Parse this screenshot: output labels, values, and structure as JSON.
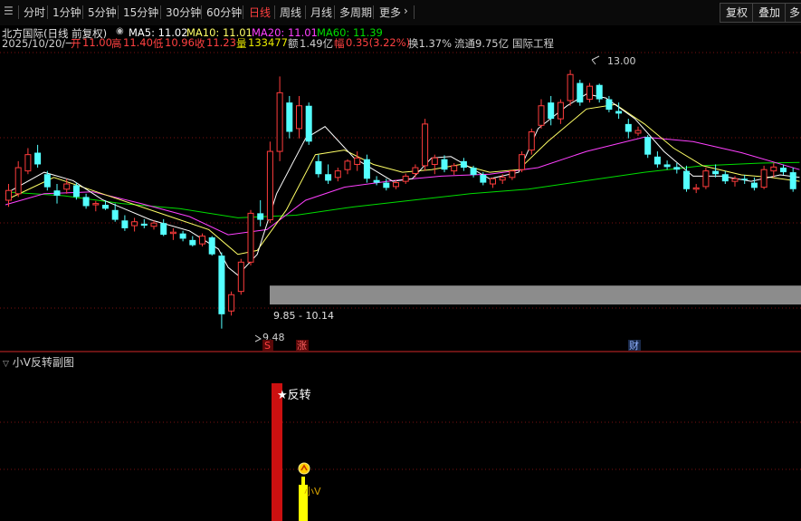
{
  "toolbar": {
    "timeframes": [
      "分时",
      "1分钟",
      "5分钟",
      "15分钟",
      "30分钟",
      "60分钟",
      "日线",
      "周线",
      "月线",
      "多周期",
      "更多"
    ],
    "more_arrow": "›",
    "active": "日线",
    "right_buttons": [
      "复权",
      "叠加",
      "多"
    ]
  },
  "info": {
    "name": "北方国际(日线 前复权)",
    "ma5": "MA5: 11.02",
    "ma10": "MA10: 11.01",
    "ma20": "MA20: 11.01",
    "ma60": "MA60: 11.39"
  },
  "quote": {
    "date": "2025/10/20/一",
    "open_label": "开",
    "open": "11.00",
    "high_label": "高",
    "high": "11.40",
    "low_label": "低",
    "low": "10.96",
    "close_label": "收",
    "close": "11.23",
    "vol_label": "量",
    "vol": "133477",
    "amount_label": "额",
    "amount": "1.49亿",
    "change_label": "幅",
    "change": "0.35(3.22%)",
    "turnover": "换1.37%",
    "float": "流通9.75亿",
    "industry": "国际工程"
  },
  "annotations": {
    "high_mark": "13.00",
    "low_mark": "9.48",
    "zone_label": "9.85 - 10.14",
    "marker_s": "S",
    "marker_zhang": "涨",
    "marker_cai": "财"
  },
  "subpanel": {
    "title": "小V反转副图",
    "reversal_label": "★反转",
    "small_v_label": "小V"
  },
  "colors": {
    "up": "#ff3c3c",
    "down": "#54ffff",
    "ma5": "#ffffff",
    "ma10": "#ffff66",
    "ma20": "#ff40ff",
    "ma60": "#00dd00",
    "zone": "#8c8c8c"
  },
  "chart_data": {
    "type": "candlestick",
    "ylim": [
      9.35,
      13.55
    ],
    "candles": [
      [
        11.45,
        11.7,
        11.35,
        11.6
      ],
      [
        11.55,
        12.05,
        11.5,
        11.95
      ],
      [
        11.9,
        12.25,
        11.85,
        12.15
      ],
      [
        12.18,
        12.3,
        11.95,
        12.0
      ],
      [
        11.85,
        11.9,
        11.6,
        11.65
      ],
      [
        11.6,
        11.7,
        11.4,
        11.52
      ],
      [
        11.62,
        11.78,
        11.55,
        11.7
      ],
      [
        11.68,
        11.72,
        11.46,
        11.5
      ],
      [
        11.5,
        11.55,
        11.32,
        11.36
      ],
      [
        11.38,
        11.44,
        11.28,
        11.4
      ],
      [
        11.38,
        11.45,
        11.3,
        11.32
      ],
      [
        11.3,
        11.4,
        11.12,
        11.15
      ],
      [
        11.14,
        11.22,
        10.98,
        11.02
      ],
      [
        11.06,
        11.18,
        10.97,
        11.12
      ],
      [
        11.09,
        11.16,
        11.02,
        11.06
      ],
      [
        11.05,
        11.14,
        11.0,
        11.1
      ],
      [
        11.1,
        11.16,
        10.9,
        10.92
      ],
      [
        10.94,
        11.02,
        10.84,
        10.96
      ],
      [
        10.94,
        10.98,
        10.82,
        10.86
      ],
      [
        10.84,
        10.9,
        10.74,
        10.76
      ],
      [
        10.78,
        10.94,
        10.74,
        10.9
      ],
      [
        10.88,
        10.9,
        10.6,
        10.62
      ],
      [
        10.6,
        10.65,
        9.48,
        9.7
      ],
      [
        9.75,
        10.05,
        9.68,
        10.0
      ],
      [
        10.05,
        10.55,
        10.0,
        10.5
      ],
      [
        10.5,
        11.3,
        10.45,
        11.25
      ],
      [
        11.25,
        11.45,
        11.05,
        11.15
      ],
      [
        11.15,
        12.35,
        11.1,
        12.2
      ],
      [
        12.2,
        13.35,
        12.05,
        13.1
      ],
      [
        12.95,
        13.05,
        12.4,
        12.5
      ],
      [
        12.55,
        13.05,
        12.4,
        12.9
      ],
      [
        12.9,
        12.95,
        12.3,
        12.35
      ],
      [
        12.05,
        12.15,
        11.8,
        11.85
      ],
      [
        11.85,
        12.0,
        11.7,
        11.75
      ],
      [
        11.8,
        11.95,
        11.74,
        11.9
      ],
      [
        11.92,
        12.08,
        11.85,
        12.05
      ],
      [
        12.0,
        12.2,
        11.9,
        12.1
      ],
      [
        12.08,
        12.15,
        11.72,
        11.78
      ],
      [
        11.76,
        11.82,
        11.68,
        11.72
      ],
      [
        11.72,
        11.78,
        11.6,
        11.64
      ],
      [
        11.66,
        11.76,
        11.62,
        11.72
      ],
      [
        11.74,
        11.86,
        11.7,
        11.82
      ],
      [
        11.86,
        12.0,
        11.8,
        11.95
      ],
      [
        11.98,
        12.7,
        11.9,
        12.62
      ],
      [
        12.0,
        12.15,
        11.85,
        12.1
      ],
      [
        12.08,
        12.14,
        11.88,
        11.92
      ],
      [
        11.9,
        12.02,
        11.84,
        11.98
      ],
      [
        12.05,
        12.1,
        11.9,
        11.95
      ],
      [
        11.95,
        11.98,
        11.8,
        11.84
      ],
      [
        11.84,
        11.88,
        11.68,
        11.72
      ],
      [
        11.7,
        11.8,
        11.64,
        11.78
      ],
      [
        11.76,
        11.85,
        11.7,
        11.8
      ],
      [
        11.8,
        11.92,
        11.76,
        11.9
      ],
      [
        11.92,
        12.2,
        11.88,
        12.15
      ],
      [
        12.22,
        12.55,
        12.15,
        12.5
      ],
      [
        12.6,
        13.0,
        12.55,
        12.9
      ],
      [
        12.95,
        13.05,
        12.6,
        12.7
      ],
      [
        12.7,
        13.0,
        12.62,
        12.95
      ],
      [
        12.98,
        13.45,
        12.9,
        13.38
      ],
      [
        13.25,
        13.3,
        12.9,
        12.95
      ],
      [
        13.0,
        13.25,
        12.95,
        13.2
      ],
      [
        13.22,
        13.24,
        12.95,
        13.0
      ],
      [
        13.0,
        13.05,
        12.8,
        12.84
      ],
      [
        12.82,
        12.95,
        12.7,
        12.78
      ],
      [
        12.62,
        12.7,
        12.4,
        12.5
      ],
      [
        12.48,
        12.58,
        12.44,
        12.52
      ],
      [
        12.42,
        12.45,
        12.1,
        12.15
      ],
      [
        12.12,
        12.2,
        11.95,
        12.0
      ],
      [
        12.0,
        12.06,
        11.92,
        11.96
      ],
      [
        11.96,
        12.02,
        11.86,
        11.92
      ],
      [
        11.9,
        11.98,
        11.58,
        11.62
      ],
      [
        11.62,
        11.7,
        11.56,
        11.64
      ],
      [
        11.66,
        11.95,
        11.62,
        11.9
      ],
      [
        11.9,
        12.0,
        11.8,
        11.85
      ],
      [
        11.85,
        11.9,
        11.7,
        11.74
      ],
      [
        11.74,
        11.82,
        11.66,
        11.78
      ],
      [
        11.78,
        11.84,
        11.7,
        11.76
      ],
      [
        11.72,
        11.8,
        11.6,
        11.64
      ],
      [
        11.65,
        11.98,
        11.62,
        11.92
      ],
      [
        11.9,
        12.02,
        11.8,
        11.96
      ],
      [
        11.95,
        12.0,
        11.84,
        11.88
      ],
      [
        11.88,
        11.95,
        11.58,
        11.62
      ]
    ],
    "ma5": [
      [
        0,
        11.55
      ],
      [
        4,
        11.88
      ],
      [
        7,
        11.75
      ],
      [
        10,
        11.46
      ],
      [
        15,
        11.15
      ],
      [
        19,
        10.98
      ],
      [
        22,
        10.7
      ],
      [
        23,
        10.42
      ],
      [
        24,
        10.3
      ],
      [
        26,
        10.62
      ],
      [
        28,
        11.55
      ],
      [
        31,
        12.4
      ],
      [
        33,
        12.58
      ],
      [
        36,
        12.1
      ],
      [
        38,
        11.92
      ],
      [
        40,
        11.74
      ],
      [
        42,
        11.78
      ],
      [
        44,
        12.1
      ],
      [
        46,
        12.12
      ],
      [
        48,
        11.95
      ],
      [
        50,
        11.78
      ],
      [
        53,
        11.88
      ],
      [
        55,
        12.55
      ],
      [
        58,
        12.9
      ],
      [
        60,
        13.08
      ],
      [
        62,
        13.02
      ],
      [
        65,
        12.7
      ],
      [
        68,
        12.2
      ],
      [
        71,
        11.82
      ],
      [
        74,
        11.82
      ],
      [
        77,
        11.74
      ],
      [
        80,
        11.84
      ],
      [
        82,
        11.8
      ]
    ],
    "ma10": [
      [
        0,
        11.45
      ],
      [
        5,
        11.8
      ],
      [
        10,
        11.55
      ],
      [
        16,
        11.25
      ],
      [
        21,
        11.0
      ],
      [
        24,
        10.62
      ],
      [
        26,
        10.68
      ],
      [
        29,
        11.3
      ],
      [
        32,
        12.15
      ],
      [
        35,
        12.22
      ],
      [
        38,
        12.0
      ],
      [
        41,
        11.88
      ],
      [
        44,
        11.92
      ],
      [
        47,
        12.0
      ],
      [
        50,
        11.88
      ],
      [
        53,
        11.92
      ],
      [
        56,
        12.35
      ],
      [
        60,
        12.85
      ],
      [
        63,
        12.92
      ],
      [
        66,
        12.62
      ],
      [
        69,
        12.25
      ],
      [
        72,
        11.98
      ],
      [
        76,
        11.84
      ],
      [
        79,
        11.8
      ],
      [
        82,
        11.74
      ]
    ],
    "ma20": [
      [
        0,
        11.38
      ],
      [
        4,
        11.55
      ],
      [
        9,
        11.58
      ],
      [
        14,
        11.4
      ],
      [
        19,
        11.2
      ],
      [
        23,
        10.92
      ],
      [
        27,
        11.0
      ],
      [
        31,
        11.45
      ],
      [
        35,
        11.65
      ],
      [
        40,
        11.75
      ],
      [
        45,
        11.82
      ],
      [
        50,
        11.85
      ],
      [
        55,
        11.95
      ],
      [
        60,
        12.2
      ],
      [
        66,
        12.42
      ],
      [
        71,
        12.35
      ],
      [
        76,
        12.18
      ],
      [
        82,
        11.92
      ]
    ],
    "ma60": [
      [
        0,
        11.58
      ],
      [
        6,
        11.52
      ],
      [
        12,
        11.4
      ],
      [
        18,
        11.32
      ],
      [
        24,
        11.18
      ],
      [
        30,
        11.22
      ],
      [
        36,
        11.35
      ],
      [
        42,
        11.45
      ],
      [
        48,
        11.55
      ],
      [
        54,
        11.62
      ],
      [
        60,
        11.75
      ],
      [
        66,
        11.88
      ],
      [
        72,
        11.98
      ],
      [
        78,
        12.02
      ],
      [
        82,
        12.03
      ]
    ]
  }
}
